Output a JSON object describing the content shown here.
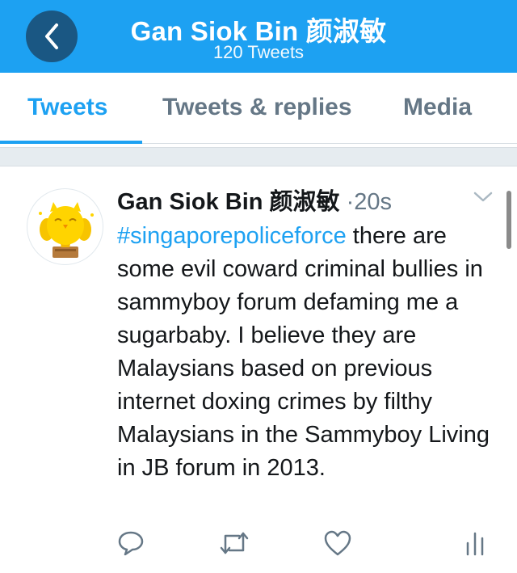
{
  "header": {
    "title": "Gan Siok Bin 颜淑敏",
    "subtitle": "120 Tweets",
    "back_icon": "chevron-left-icon"
  },
  "tabs": [
    {
      "label": "Tweets",
      "active": true
    },
    {
      "label": "Tweets & replies",
      "active": false
    },
    {
      "label": "Media",
      "active": false
    }
  ],
  "tweet": {
    "author": "Gan Siok Bin 颜淑敏",
    "separator": "·",
    "time": "20s",
    "hashtag": "#singaporepoliceforce",
    "text": " there are some evil coward criminal bullies in sammyboy forum defaming me a sugarbaby. I believe they are Malaysians based on previous internet doxing crimes by filthy Malaysians in the Sammyboy Living in JB forum in 2013.",
    "avatar_icon": "owl-trophy-avatar",
    "menu_icon": "chevron-down-icon"
  },
  "actions": [
    {
      "name": "reply-icon"
    },
    {
      "name": "retweet-icon"
    },
    {
      "name": "like-icon"
    },
    {
      "name": "analytics-icon"
    }
  ],
  "colors": {
    "accent": "#1da1f2",
    "back_button": "#1a5783",
    "muted": "#657786",
    "text": "#14171a"
  }
}
